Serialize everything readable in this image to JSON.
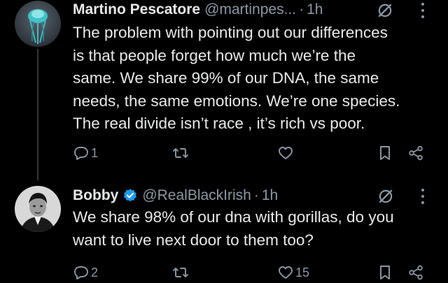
{
  "tweets": [
    {
      "name": "Martino Pescatore",
      "handle": "@martinpes...",
      "separator": "·",
      "time": "1h",
      "lines": [
        "The problem with pointing out our differences",
        "is that people forget how much we’re the",
        "same. We share 99% of our DNA, the same",
        "needs, the same emotions. We’re one species.",
        "The real divide isn’t race , it’s rich vs poor."
      ],
      "replies": "1",
      "retweets": "",
      "likes": "",
      "avatar_icon": "jellyfish-avatar"
    },
    {
      "name": "Bobby",
      "handle": "@RealBlackIrish",
      "separator": "·",
      "time": "1h",
      "verified": true,
      "lines": [
        "We share 98% of our dna with gorillas, do you",
        "want to live next door to them too?"
      ],
      "replies": "2",
      "retweets": "",
      "likes": "15",
      "avatar_icon": "man-portrait-avatar"
    }
  ],
  "colors": {
    "background": "#000000",
    "text": "#e7e9ea",
    "secondary": "#8b98a5",
    "verified": "#1d9bf0",
    "thread_line": "#333639"
  },
  "icons": [
    "reply-icon",
    "retweet-icon",
    "like-icon",
    "bookmark-icon",
    "share-icon",
    "grok-icon",
    "more-icon",
    "verified-badge-icon"
  ]
}
